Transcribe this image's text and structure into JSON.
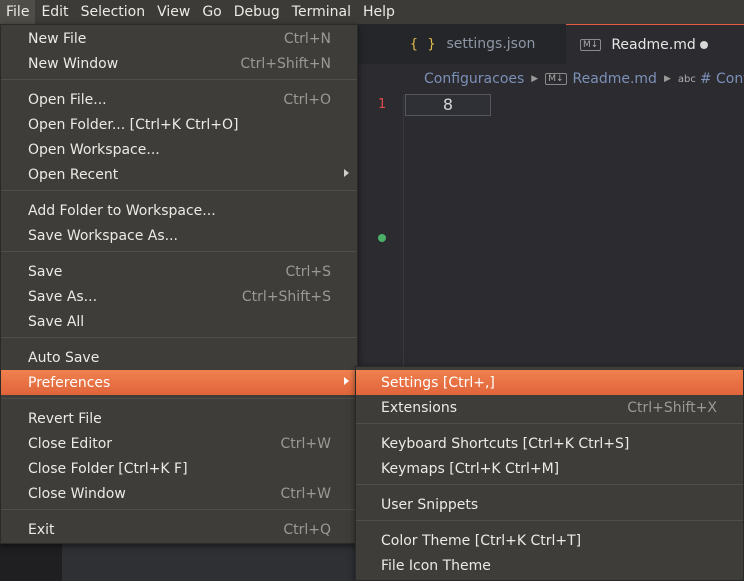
{
  "menubar": [
    "File",
    "Edit",
    "Selection",
    "View",
    "Go",
    "Debug",
    "Terminal",
    "Help"
  ],
  "tabs": {
    "settings": {
      "icon": "{ }",
      "label": "settings.json"
    },
    "readme": {
      "icon": "M↓",
      "label": "Readme.md"
    }
  },
  "breadcrumbs": {
    "folder": "Configuracoes",
    "file_icon": "M↓",
    "file": "Readme.md",
    "symbol_icon": "abc",
    "symbol": "# Confi"
  },
  "gutter": {
    "line_number": "1"
  },
  "editor": {
    "cell_value": "8"
  },
  "file_menu": [
    {
      "label": "New File",
      "shortcut": "Ctrl+N"
    },
    {
      "label": "New Window",
      "shortcut": "Ctrl+Shift+N"
    },
    {
      "label": "Open File...",
      "shortcut": "Ctrl+O"
    },
    {
      "label": "Open Folder... [Ctrl+K Ctrl+O]",
      "shortcut": ""
    },
    {
      "label": "Open Workspace...",
      "shortcut": ""
    },
    {
      "label": "Open Recent",
      "shortcut": ""
    },
    {
      "label": "Add Folder to Workspace...",
      "shortcut": ""
    },
    {
      "label": "Save Workspace As...",
      "shortcut": ""
    },
    {
      "label": "Save",
      "shortcut": "Ctrl+S"
    },
    {
      "label": "Save As...",
      "shortcut": "Ctrl+Shift+S"
    },
    {
      "label": "Save All",
      "shortcut": ""
    },
    {
      "label": "Auto Save",
      "shortcut": ""
    },
    {
      "label": "Preferences",
      "shortcut": ""
    },
    {
      "label": "Revert File",
      "shortcut": ""
    },
    {
      "label": "Close Editor",
      "shortcut": "Ctrl+W"
    },
    {
      "label": "Close Folder [Ctrl+K F]",
      "shortcut": ""
    },
    {
      "label": "Close Window",
      "shortcut": "Ctrl+W"
    },
    {
      "label": "Exit",
      "shortcut": "Ctrl+Q"
    }
  ],
  "pref_menu": [
    {
      "label": "Settings [Ctrl+,]",
      "shortcut": ""
    },
    {
      "label": "Extensions",
      "shortcut": "Ctrl+Shift+X"
    },
    {
      "label": "Keyboard Shortcuts [Ctrl+K Ctrl+S]",
      "shortcut": ""
    },
    {
      "label": "Keymaps [Ctrl+K Ctrl+M]",
      "shortcut": ""
    },
    {
      "label": "User Snippets",
      "shortcut": ""
    },
    {
      "label": "Color Theme [Ctrl+K Ctrl+T]",
      "shortcut": ""
    },
    {
      "label": "File Icon Theme",
      "shortcut": ""
    }
  ],
  "colors": {
    "highlight": "#e8703f",
    "menu_bg": "#3e3d39",
    "menubar_bg": "#3c3b37"
  }
}
